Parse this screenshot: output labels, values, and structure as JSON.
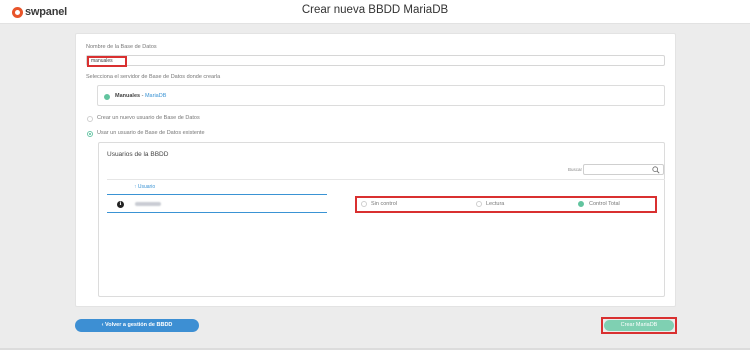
{
  "header": {
    "logo_text": "swpanel",
    "title": "Crear nueva BBDD MariaDB"
  },
  "form": {
    "db_name_label": "Nombre de la Base de Datos",
    "db_name_value": "manuales",
    "server_label": "Selecciona el servidor de Base de Datos donde crearla",
    "server_name": "Manuales",
    "server_sep": " - ",
    "server_engine": "MariaDB",
    "option_new_user": "Crear un nuevo usuario de Base de Datos",
    "option_existing_user": "Usar un usuario de Base de Datos existente",
    "selected_user_option": "Usar un usuario de Base de Datos existente"
  },
  "users": {
    "title": "Usuarios de la BBDD",
    "search_label": "Buscar",
    "search_placeholder": "",
    "column_user": "↑ Usuario",
    "permissions": [
      "Sin control",
      "Lectura",
      "Control Total"
    ],
    "selected_permission": "Control Total"
  },
  "actions": {
    "back_label": "‹ Volver a gestión de BBDD",
    "create_label": "Crear MariaDB"
  },
  "colors": {
    "accent_green": "#62c49f",
    "accent_blue": "#3d8fd3",
    "highlight_red": "#d93030",
    "brand_orange": "#e8542a"
  }
}
